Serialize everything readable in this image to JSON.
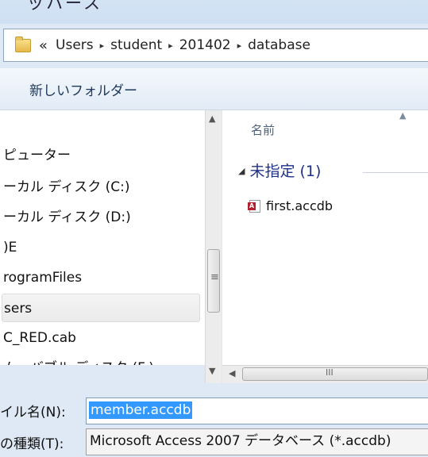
{
  "window": {
    "title_fragment": "ッハース"
  },
  "address_bar": {
    "overflow_chevron": "«",
    "separator": "▸",
    "crumbs": [
      "Users",
      "student",
      "201402",
      "database"
    ]
  },
  "toolbar": {
    "new_folder_label": "新しいフォルダー"
  },
  "nav_pane": {
    "items": [
      {
        "label": "ピューター"
      },
      {
        "label": "ーカル ディスク (C:)"
      },
      {
        "label": "ーカル ディスク (D:)"
      },
      {
        "label": ")E"
      },
      {
        "label": "rogramFiles"
      },
      {
        "label": "sers",
        "selected": true
      },
      {
        "label": "C_RED.cab"
      },
      {
        "label": "ムーバブル ディスク (F:)"
      }
    ]
  },
  "content_pane": {
    "column_header": "名前",
    "group": {
      "label": "未指定 (1)"
    },
    "files": [
      {
        "name": "first.accdb",
        "icon": "access-db-icon"
      }
    ]
  },
  "form": {
    "filename_label": "イル名(N):",
    "filename_value": "member.accdb",
    "filetype_label": "の種類(T):",
    "filetype_value": "Microsoft Access 2007 データベース (*.accdb)"
  },
  "scroll_glyphs": {
    "up": "▲",
    "down": "▼",
    "left": "◀",
    "grip_v": "≡",
    "grip_h": "III"
  }
}
